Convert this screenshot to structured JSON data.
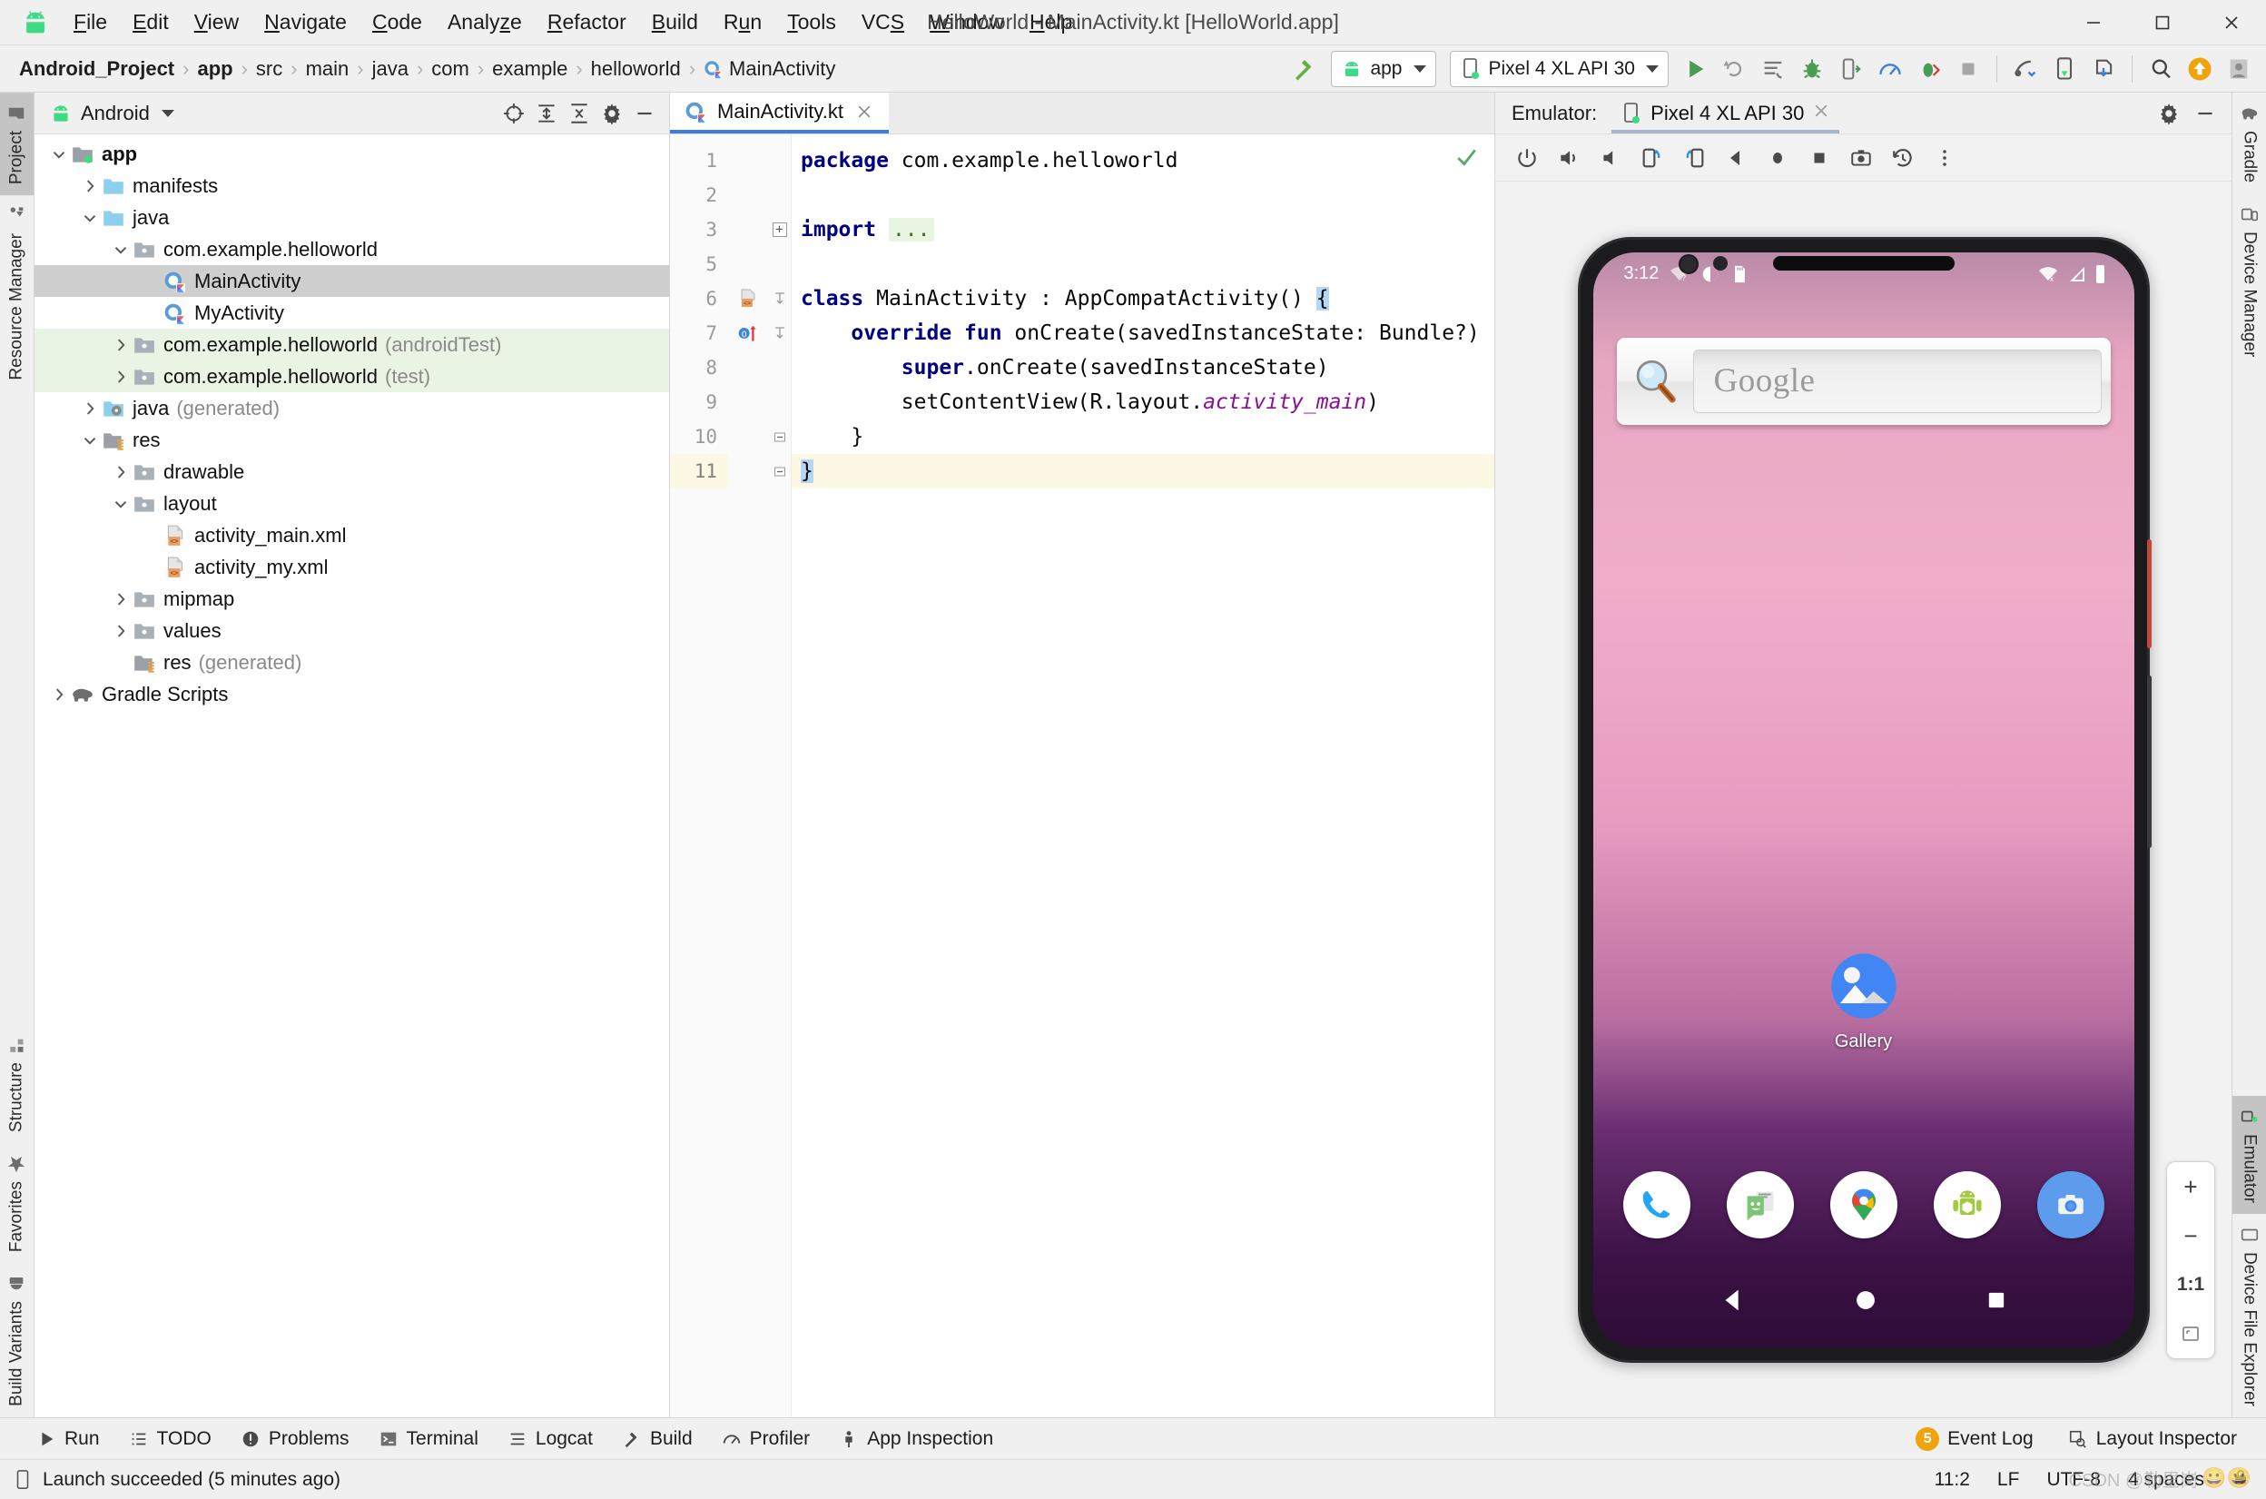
{
  "window": {
    "title": "HelloWorld - MainActivity.kt [HelloWorld.app]",
    "minimize": "minimize",
    "maximize": "maximize",
    "close": "close"
  },
  "menu": [
    {
      "label": "File",
      "mnemonic": "F"
    },
    {
      "label": "Edit",
      "mnemonic": "E"
    },
    {
      "label": "View",
      "mnemonic": "V"
    },
    {
      "label": "Navigate",
      "mnemonic": "N"
    },
    {
      "label": "Code",
      "mnemonic": "C"
    },
    {
      "label": "Analyze",
      "mnemonic": "z"
    },
    {
      "label": "Refactor",
      "mnemonic": "R"
    },
    {
      "label": "Build",
      "mnemonic": "B"
    },
    {
      "label": "Run",
      "mnemonic": "u"
    },
    {
      "label": "Tools",
      "mnemonic": "T"
    },
    {
      "label": "VCS",
      "mnemonic": "S"
    },
    {
      "label": "Window",
      "mnemonic": "W"
    },
    {
      "label": "Help",
      "mnemonic": "H"
    }
  ],
  "breadcrumb": [
    {
      "label": "Android_Project",
      "bold": true,
      "icon": null
    },
    {
      "label": "app",
      "bold": true,
      "icon": null
    },
    {
      "label": "src",
      "bold": false,
      "icon": null
    },
    {
      "label": "main",
      "bold": false,
      "icon": null
    },
    {
      "label": "java",
      "bold": false,
      "icon": null
    },
    {
      "label": "com",
      "bold": false,
      "icon": null
    },
    {
      "label": "example",
      "bold": false,
      "icon": null
    },
    {
      "label": "helloworld",
      "bold": false,
      "icon": null
    },
    {
      "label": "MainActivity",
      "bold": false,
      "icon": "kotlin-class-icon"
    }
  ],
  "toolbar": {
    "module_selector": "app",
    "device_selector": "Pixel 4 XL API 30",
    "icons": [
      "run-icon",
      "rerun-icon",
      "apply-changes-icon",
      "debug-icon",
      "attach-debugger-icon",
      "profiler-icon",
      "debug-script-icon",
      "stop-icon",
      "sdk-manager-icon",
      "avd-manager-icon",
      "sync-gradle-icon",
      "search-everywhere-icon",
      "update-project-icon",
      "account-icon"
    ],
    "make_project_icon": "build-hammer-icon"
  },
  "left_strip": [
    {
      "label": "Project",
      "icon": "project-folder-icon",
      "active": true
    },
    {
      "label": "Resource Manager",
      "icon": "resource-manager-icon",
      "active": false
    }
  ],
  "left_strip_bottom": [
    {
      "label": "Structure",
      "icon": "structure-icon",
      "active": false
    },
    {
      "label": "Favorites",
      "icon": "star-icon",
      "active": false
    },
    {
      "label": "Build Variants",
      "icon": "android-icon",
      "active": false
    }
  ],
  "right_strip_top": [
    {
      "label": "Gradle",
      "icon": "gradle-elephant-icon",
      "active": false
    },
    {
      "label": "Device Manager",
      "icon": "device-manager-icon",
      "active": false
    }
  ],
  "right_strip_bottom": [
    {
      "label": "Emulator",
      "icon": "emulator-icon",
      "active": true
    },
    {
      "label": "Device File Explorer",
      "icon": "device-file-explorer-icon",
      "active": false
    }
  ],
  "project_panel": {
    "title": "Android",
    "actions": [
      "select-opened-file-icon",
      "expand-all-icon",
      "collapse-all-icon",
      "settings-gear-icon",
      "hide-icon"
    ],
    "tree": [
      {
        "label": "app",
        "depth": 0,
        "expand": "open",
        "icon": "module-folder-icon",
        "bold": true,
        "dim": "",
        "state": "normal"
      },
      {
        "label": "manifests",
        "depth": 1,
        "expand": "closed",
        "icon": "folder-blue-icon",
        "bold": false,
        "dim": "",
        "state": "normal"
      },
      {
        "label": "java",
        "depth": 1,
        "expand": "open",
        "icon": "folder-blue-icon",
        "bold": false,
        "dim": "",
        "state": "normal"
      },
      {
        "label": "com.example.helloworld",
        "depth": 2,
        "expand": "open",
        "icon": "package-icon",
        "bold": false,
        "dim": "",
        "state": "normal"
      },
      {
        "label": "MainActivity",
        "depth": 3,
        "expand": "none",
        "icon": "kotlin-class-icon",
        "bold": false,
        "dim": "",
        "state": "selected"
      },
      {
        "label": "MyActivity",
        "depth": 3,
        "expand": "none",
        "icon": "kotlin-class-icon",
        "bold": false,
        "dim": "",
        "state": "normal"
      },
      {
        "label": "com.example.helloworld",
        "depth": 2,
        "expand": "closed",
        "icon": "package-icon",
        "bold": false,
        "dim": "(androidTest)",
        "state": "testsrc"
      },
      {
        "label": "com.example.helloworld",
        "depth": 2,
        "expand": "closed",
        "icon": "package-icon",
        "bold": false,
        "dim": "(test)",
        "state": "testsrc"
      },
      {
        "label": "java",
        "depth": 1,
        "expand": "closed",
        "icon": "folder-generated-icon",
        "bold": false,
        "dim": "(generated)",
        "state": "normal"
      },
      {
        "label": "res",
        "depth": 1,
        "expand": "open",
        "icon": "res-folder-icon",
        "bold": false,
        "dim": "",
        "state": "normal"
      },
      {
        "label": "drawable",
        "depth": 2,
        "expand": "closed",
        "icon": "package-icon",
        "bold": false,
        "dim": "",
        "state": "normal"
      },
      {
        "label": "layout",
        "depth": 2,
        "expand": "open",
        "icon": "package-icon",
        "bold": false,
        "dim": "",
        "state": "normal"
      },
      {
        "label": "activity_main.xml",
        "depth": 3,
        "expand": "none",
        "icon": "xml-layout-icon",
        "bold": false,
        "dim": "",
        "state": "normal"
      },
      {
        "label": "activity_my.xml",
        "depth": 3,
        "expand": "none",
        "icon": "xml-layout-icon",
        "bold": false,
        "dim": "",
        "state": "normal"
      },
      {
        "label": "mipmap",
        "depth": 2,
        "expand": "closed",
        "icon": "package-icon",
        "bold": false,
        "dim": "",
        "state": "normal"
      },
      {
        "label": "values",
        "depth": 2,
        "expand": "closed",
        "icon": "package-icon",
        "bold": false,
        "dim": "",
        "state": "normal"
      },
      {
        "label": "res",
        "depth": 2,
        "expand": "none",
        "icon": "res-folder-icon",
        "bold": false,
        "dim": "(generated)",
        "state": "normal"
      },
      {
        "label": "Gradle Scripts",
        "depth": 0,
        "expand": "closed",
        "icon": "gradle-elephant-icon",
        "bold": false,
        "dim": "",
        "state": "normal"
      }
    ]
  },
  "editor": {
    "tab": {
      "label": "MainActivity.kt",
      "icon": "kotlin-file-icon",
      "close": "×"
    },
    "inspection_status": "no-errors-check-icon",
    "lines": [
      {
        "num": "1",
        "highlight": false,
        "fold": "",
        "mark": "",
        "html": "<span class=\"kw\">package</span> com.example.helloworld"
      },
      {
        "num": "2",
        "highlight": false,
        "fold": "",
        "mark": "",
        "html": ""
      },
      {
        "num": "3",
        "highlight": false,
        "fold": "plus",
        "mark": "",
        "html": "<span class=\"kw\">import</span> <span class=\"fold-ellipsis\">...</span>"
      },
      {
        "num": "5",
        "highlight": false,
        "fold": "",
        "mark": "",
        "html": ""
      },
      {
        "num": "6",
        "highlight": false,
        "fold": "top",
        "mark": "layout-xml-icon",
        "html": "<span class=\"kw\">class</span> MainActivity : AppCompatActivity() <span class=\"brace-hl\">{</span>"
      },
      {
        "num": "7",
        "highlight": false,
        "fold": "top",
        "mark": "override-icon",
        "html": "    <span class=\"kw\">override fun</span> onCreate(savedInstanceState: Bundle?) {"
      },
      {
        "num": "8",
        "highlight": false,
        "fold": "",
        "mark": "",
        "html": "        <span class=\"kw\">super</span>.onCreate(savedInstanceState)"
      },
      {
        "num": "9",
        "highlight": false,
        "fold": "",
        "mark": "",
        "html": "        setContentView(R.layout.<span class=\"prop\">activity_main</span>)"
      },
      {
        "num": "10",
        "highlight": false,
        "fold": "bottom",
        "mark": "",
        "html": "    }"
      },
      {
        "num": "11",
        "highlight": true,
        "fold": "bottom",
        "mark": "",
        "html": "<span class=\"brace-hl\">}</span>"
      }
    ]
  },
  "emulator": {
    "panel_label": "Emulator:",
    "tab_label": "Pixel 4 XL API 30",
    "tab_close": "×",
    "head_actions": [
      "settings-gear-icon",
      "hide-icon"
    ],
    "toolbar_icons": [
      "power-icon",
      "volume-up-icon",
      "volume-down-icon",
      "rotate-left-icon",
      "rotate-right-icon",
      "back-icon",
      "home-icon",
      "overview-icon",
      "screenshot-icon",
      "history-icon",
      "more-vertical-icon"
    ],
    "zoom_controls": {
      "zoom_in": "+",
      "zoom_out": "−",
      "actual_size": "1:1",
      "fit": "fit-screen-icon"
    },
    "device_screen": {
      "status_time": "3:12",
      "status_left_icons": [
        "wifi-unknown-icon",
        "cast-icon",
        "sdcard-icon"
      ],
      "status_right_icons": [
        "wifi-off-icon",
        "signal-icon",
        "battery-icon"
      ],
      "search_widget": {
        "icon": "magnifier-icon",
        "placeholder": "Google"
      },
      "desktop_icons": [
        {
          "label": "Gallery",
          "icon": "gallery-icon"
        }
      ],
      "dock": [
        {
          "label": "Phone",
          "icon": "phone-icon"
        },
        {
          "label": "Messages",
          "icon": "messages-icon"
        },
        {
          "label": "Maps",
          "icon": "maps-icon"
        },
        {
          "label": "API Demos",
          "icon": "android-demos-icon"
        },
        {
          "label": "Camera",
          "icon": "camera-icon"
        }
      ],
      "nav_bar": [
        "back-triangle-icon",
        "home-circle-icon",
        "recents-square-icon"
      ]
    }
  },
  "bottom_toolwindows": [
    {
      "label": "Run",
      "icon": "run-triangle-icon"
    },
    {
      "label": "TODO",
      "icon": "todo-list-icon"
    },
    {
      "label": "Problems",
      "icon": "problems-icon"
    },
    {
      "label": "Terminal",
      "icon": "terminal-icon"
    },
    {
      "label": "Logcat",
      "icon": "logcat-icon"
    },
    {
      "label": "Build",
      "icon": "build-hammer-icon"
    },
    {
      "label": "Profiler",
      "icon": "profiler-icon"
    },
    {
      "label": "App Inspection",
      "icon": "app-inspection-icon"
    }
  ],
  "bottom_toolwindows_right": [
    {
      "label": "Event Log",
      "icon": "event-log-badge",
      "badge": "5"
    },
    {
      "label": "Layout Inspector",
      "icon": "layout-inspector-icon",
      "badge": ""
    }
  ],
  "statusbar": {
    "message": "Launch succeeded (5 minutes ago)",
    "message_icon": "device-icon",
    "caret_position": "11:2",
    "line_separator": "LF",
    "encoding": "UTF-8",
    "indent": "4 spaces",
    "lock_icon": "lock-icon",
    "watermark": "CSDN @勒里岗"
  },
  "colors": {
    "accent_blue": "#3b7ddd",
    "android_green": "#3ddc84",
    "selection_gray": "#cfcfcf",
    "test_source_green": "#eaf4e4",
    "caret_line": "#fdf8e3",
    "keyword_blue": "#000082",
    "property_purple": "#871094",
    "badge_orange": "#f0a30a"
  }
}
